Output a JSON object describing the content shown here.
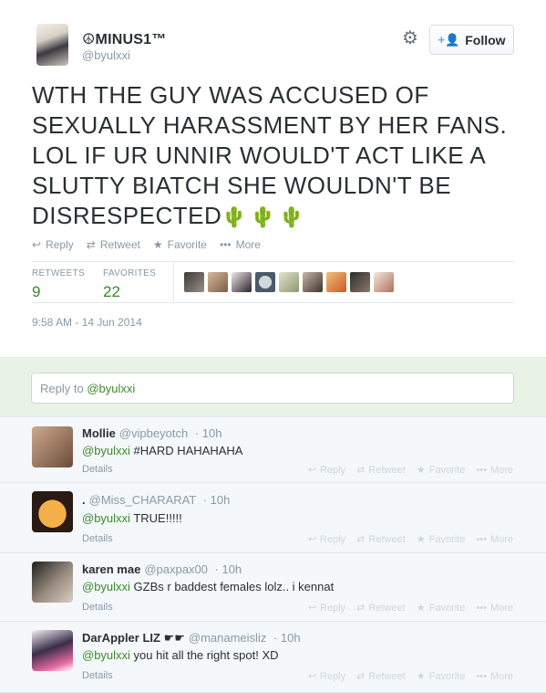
{
  "tweet": {
    "fullname": "☮MINUS1™",
    "username": "@byulxxi",
    "follow_label": "Follow",
    "text": "WTH THE GUY WAS ACCUSED OF SEXUALLY HARASSMENT BY HER FANS. LOL IF UR UNNIR WOULD'T ACT LIKE A SLUTTY BIATCH SHE WOULDN'T BE DISRESPECTED",
    "emoji": "🌵🌵🌵",
    "actions": {
      "reply": "Reply",
      "retweet": "Retweet",
      "favorite": "Favorite",
      "more": "More"
    },
    "stats": {
      "retweets_label": "RETWEETS",
      "retweets_value": "9",
      "favorites_label": "FAVORITES",
      "favorites_value": "22"
    },
    "timestamp": "9:58 AM - 14 Jun 2014"
  },
  "reply_box": {
    "prefix": "Reply to ",
    "mention": "@byulxxi"
  },
  "replies": [
    {
      "name": "Mollie",
      "handle": "@vipbeyotch",
      "time": "· 10h",
      "mention": "@byulxxi",
      "text": " #HARD HAHAHAHA",
      "details": "Details"
    },
    {
      "name": ".",
      "handle": "@Miss_CHARARAT",
      "time": "· 10h",
      "mention": "@byulxxi",
      "text": " TRUE!!!!!",
      "details": "Details"
    },
    {
      "name": "karen mae",
      "handle": "@paxpax00",
      "time": "· 10h",
      "mention": "@byulxxi",
      "text": " GZBs r baddest females lolz.. i kennat",
      "details": "Details"
    },
    {
      "name": "DarAppler LIZ ☛☛",
      "handle": "@manameisliz",
      "time": "· 10h",
      "mention": "@byulxxi",
      "text": " you hit all the right spot! XD",
      "details": "Details"
    }
  ],
  "reply_actions": {
    "reply": "Reply",
    "retweet": "Retweet",
    "favorite": "Favorite",
    "more": "More"
  },
  "colors": {
    "accent_green": "#3a8a2c",
    "muted": "#8899a6",
    "reply_bg": "#e8f3e6"
  }
}
